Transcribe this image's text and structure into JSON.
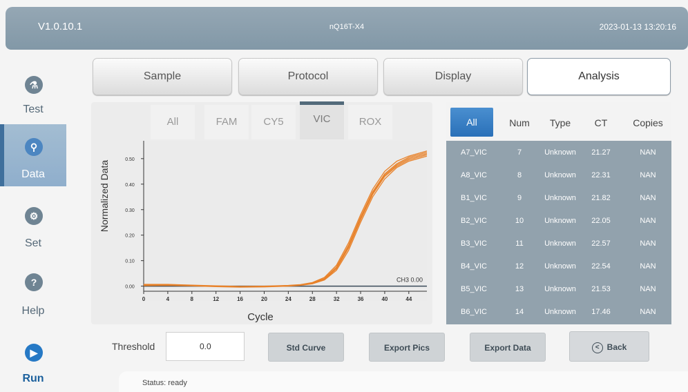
{
  "header": {
    "version": "V1.0.10.1",
    "model": "nQ16T-X4",
    "datetime": "2023-01-13 13:20:16"
  },
  "sidebar": {
    "items": [
      {
        "label": "Test",
        "icon": "flask-icon"
      },
      {
        "label": "Data",
        "icon": "search-icon"
      },
      {
        "label": "Set",
        "icon": "gear-icon"
      },
      {
        "label": "Help",
        "icon": "help-icon"
      },
      {
        "label": "Run",
        "icon": "play-icon"
      }
    ]
  },
  "tabs": [
    "Sample",
    "Protocol",
    "Display",
    "Analysis"
  ],
  "active_tab": "Analysis",
  "channels": [
    "All",
    "FAM",
    "CY5",
    "VIC",
    "ROX"
  ],
  "active_channel": "VIC",
  "table": {
    "headers": [
      "All",
      "Num",
      "Type",
      "CT",
      "Copies"
    ],
    "rows": [
      [
        "A7_VIC",
        "7",
        "Unknown",
        "21.27",
        "NAN"
      ],
      [
        "A8_VIC",
        "8",
        "Unknown",
        "22.31",
        "NAN"
      ],
      [
        "B1_VIC",
        "9",
        "Unknown",
        "21.82",
        "NAN"
      ],
      [
        "B2_VIC",
        "10",
        "Unknown",
        "22.05",
        "NAN"
      ],
      [
        "B3_VIC",
        "11",
        "Unknown",
        "22.57",
        "NAN"
      ],
      [
        "B4_VIC",
        "12",
        "Unknown",
        "22.54",
        "NAN"
      ],
      [
        "B5_VIC",
        "13",
        "Unknown",
        "21.53",
        "NAN"
      ],
      [
        "B6_VIC",
        "14",
        "Unknown",
        "17.46",
        "NAN"
      ]
    ]
  },
  "controls": {
    "threshold_label": "Threshold",
    "threshold_value": "0.0",
    "std_curve": "Std Curve",
    "export_pics": "Export Pics",
    "export_data": "Export Data",
    "back": "Back"
  },
  "status": "Status: ready",
  "chart_data": {
    "type": "line",
    "xlabel": "Cycle",
    "ylabel": "Normalized Data",
    "xlim": [
      0,
      47
    ],
    "ylim": [
      -0.02,
      0.57
    ],
    "xticks": [
      0,
      4,
      8,
      12,
      16,
      20,
      24,
      28,
      32,
      36,
      40,
      44
    ],
    "yticks": [
      "0.00",
      "0.10",
      "0.20",
      "0.30",
      "0.40",
      "0.50"
    ],
    "threshold_label": "CH3 0.00",
    "threshold_value": 0.0,
    "series_color": "#e8822a",
    "x": [
      0,
      4,
      8,
      12,
      16,
      20,
      24,
      26,
      28,
      30,
      32,
      34,
      36,
      38,
      40,
      42,
      44,
      47
    ],
    "series": [
      {
        "values": [
          0.005,
          0.006,
          0.003,
          0.0,
          -0.002,
          -0.001,
          0.002,
          0.005,
          0.012,
          0.03,
          0.075,
          0.16,
          0.27,
          0.37,
          0.44,
          0.48,
          0.505,
          0.525
        ]
      },
      {
        "values": [
          0.003,
          0.004,
          0.002,
          -0.001,
          -0.003,
          -0.002,
          0.001,
          0.004,
          0.01,
          0.026,
          0.068,
          0.15,
          0.26,
          0.36,
          0.43,
          0.47,
          0.495,
          0.515
        ]
      },
      {
        "values": [
          0.007,
          0.007,
          0.004,
          0.001,
          -0.001,
          0.0,
          0.003,
          0.006,
          0.014,
          0.034,
          0.082,
          0.17,
          0.28,
          0.38,
          0.45,
          0.49,
          0.51,
          0.53
        ]
      },
      {
        "values": [
          0.002,
          0.003,
          0.001,
          -0.002,
          -0.004,
          -0.003,
          0.0,
          0.003,
          0.009,
          0.024,
          0.062,
          0.14,
          0.25,
          0.35,
          0.42,
          0.465,
          0.49,
          0.51
        ]
      },
      {
        "values": [
          0.004,
          0.005,
          0.003,
          0.0,
          -0.002,
          -0.001,
          0.002,
          0.005,
          0.011,
          0.028,
          0.07,
          0.155,
          0.265,
          0.365,
          0.435,
          0.475,
          0.5,
          0.52
        ]
      }
    ]
  }
}
